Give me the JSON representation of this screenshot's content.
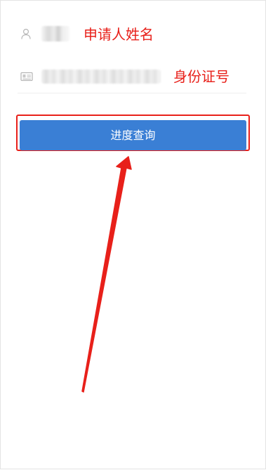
{
  "form": {
    "name_field": {
      "icon": "user-icon",
      "value": "",
      "annotation": "申请人姓名"
    },
    "id_field": {
      "icon": "id-card-icon",
      "value": "",
      "annotation": "身份证号"
    },
    "query_button": {
      "label": "进度查询"
    }
  },
  "colors": {
    "button": "#3a7fd5",
    "annotation_red": "#e8201a",
    "icon_gray": "#b5b5b5"
  }
}
